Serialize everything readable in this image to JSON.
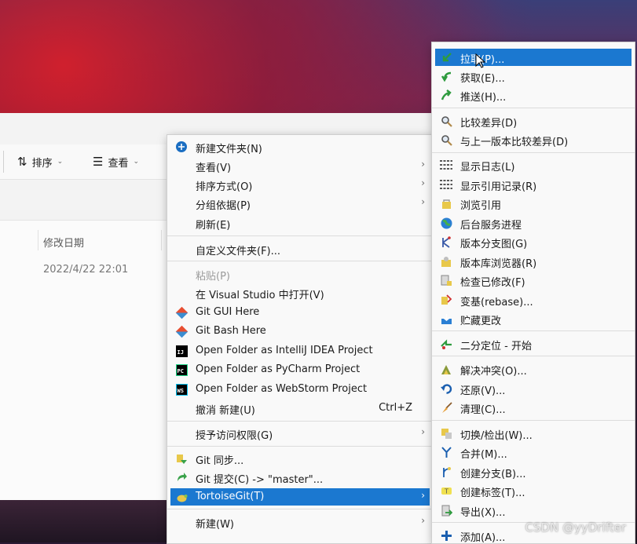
{
  "explorer": {
    "toolbar": {
      "sort_label": "排序",
      "view_label": "查看"
    },
    "column_header": "修改日期",
    "row_date": "2022/4/22 22:01"
  },
  "context_menu": {
    "items": [
      {
        "label": "新建文件夹(N)",
        "icon": "new-folder-icon"
      },
      {
        "label": "查看(V)"
      },
      {
        "label": "排序方式(O)"
      },
      {
        "label": "分组依据(P)"
      },
      {
        "label": "刷新(E)"
      },
      {
        "label": "自定义文件夹(F)..."
      },
      {
        "label": "粘贴(P)"
      },
      {
        "label": "在 Visual Studio 中打开(V)"
      },
      {
        "label": "Git GUI Here",
        "icon": "git-icon"
      },
      {
        "label": "Git Bash Here",
        "icon": "git-icon"
      },
      {
        "label": "Open Folder as IntelliJ IDEA Project",
        "icon": "intellij-icon",
        "icon_text": "IJ"
      },
      {
        "label": "Open Folder as PyCharm Project",
        "icon": "pycharm-icon",
        "icon_text": "PC"
      },
      {
        "label": "Open Folder as WebStorm Project",
        "icon": "webstorm-icon",
        "icon_text": "WS"
      },
      {
        "label": "撤消 新建(U)",
        "shortcut": "Ctrl+Z"
      },
      {
        "label": "授予访问权限(G)"
      },
      {
        "label": "Git 同步..."
      },
      {
        "label": "Git 提交(C) -> \"master\"..."
      },
      {
        "label": "TortoiseGit(T)"
      },
      {
        "label": "新建(W)"
      }
    ],
    "highlight_color": "#1b78d0"
  },
  "tortoise_menu": {
    "items": [
      {
        "label": "拉取(P)..."
      },
      {
        "label": "获取(E)..."
      },
      {
        "label": "推送(H)..."
      },
      {
        "label": "比较差异(D)"
      },
      {
        "label": "与上一版本比较差异(D)"
      },
      {
        "label": "显示日志(L)"
      },
      {
        "label": "显示引用记录(R)"
      },
      {
        "label": "浏览引用"
      },
      {
        "label": "后台服务进程"
      },
      {
        "label": "版本分支图(G)"
      },
      {
        "label": "版本库浏览器(R)"
      },
      {
        "label": "检查已修改(F)"
      },
      {
        "label": "变基(rebase)..."
      },
      {
        "label": "贮藏更改"
      },
      {
        "label": "二分定位 - 开始"
      },
      {
        "label": "解决冲突(O)..."
      },
      {
        "label": "还原(V)..."
      },
      {
        "label": "清理(C)..."
      },
      {
        "label": "切换/检出(W)..."
      },
      {
        "label": "合并(M)..."
      },
      {
        "label": "创建分支(B)..."
      },
      {
        "label": "创建标签(T)..."
      },
      {
        "label": "导出(X)..."
      },
      {
        "label": "添加(A)..."
      }
    ]
  },
  "watermark": "CSDN @yyDrifter"
}
